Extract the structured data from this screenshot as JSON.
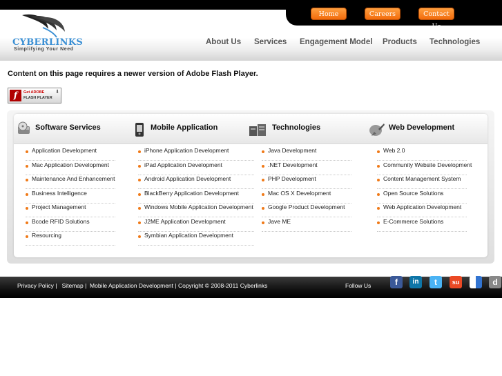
{
  "brand": {
    "name": "CYBERLINKS",
    "tagline": "Simplifying Your Need"
  },
  "top_buttons": [
    "Home",
    "Careers",
    "Contact Us"
  ],
  "nav": [
    "About Us",
    "Services",
    "Engagement Model",
    "Products",
    "Technologies"
  ],
  "flash": {
    "message": "Content on this page requires a newer version of Adobe Flash Player.",
    "button_line1": "Get ADOBE",
    "button_line2": "FLASH PLAYER"
  },
  "columns": [
    {
      "title": "Software Services",
      "icon": "disc-drive-icon",
      "items": [
        "Application Development",
        "Mac Application Development",
        "Maintenance And Enhancement",
        "Business Intelligence",
        "Project Management",
        "Bcode RFID Solutions",
        "Resourcing"
      ]
    },
    {
      "title": "Mobile Application",
      "icon": "mobile-phone-icon",
      "items": [
        "iPhone Application Development",
        "iPad Application Development",
        "Android Application Development",
        "BlackBerry Application Development",
        "Windows Mobile Application Development",
        "J2ME Application Development",
        "Symbian Application Development"
      ]
    },
    {
      "title": "Technologies",
      "icon": "server-icon",
      "items": [
        "Java Development",
        ".NET Development",
        "PHP Development",
        "Mac OS X Development",
        "Google Product Development",
        "Jave ME"
      ]
    },
    {
      "title": "Web Development",
      "icon": "pen-tool-icon",
      "items": [
        "Web 2.0",
        "Community Website Development",
        "Content Management System",
        "Open Source Solutions",
        "Web Application Development",
        "E-Commerce Solutions"
      ]
    }
  ],
  "footer": {
    "privacy": "Privacy Policy",
    "sitemap": "Sitemap",
    "mobile": "Mobile Application Development",
    "copyright": "Copyright © 2008-2011 Cyberlinks",
    "follow": "Follow Us"
  },
  "social": [
    {
      "icon": "facebook-icon",
      "glyph": "f",
      "color": "#3b5998"
    },
    {
      "icon": "linkedin-icon",
      "glyph": "in",
      "color": "#0e76a8"
    },
    {
      "icon": "twitter-icon",
      "glyph": "t",
      "color": "#4ab3f4"
    },
    {
      "icon": "stumbleupon-icon",
      "glyph": "su",
      "color": "#eb4924"
    },
    {
      "icon": "delicious-icon",
      "glyph": "",
      "color": "#3274d1"
    },
    {
      "icon": "digg-icon",
      "glyph": "d",
      "color": "#888888"
    }
  ],
  "colors": {
    "accent": "#f26b0c",
    "logo_blue": "#3a8fd4",
    "bullet": "#f07a18"
  }
}
